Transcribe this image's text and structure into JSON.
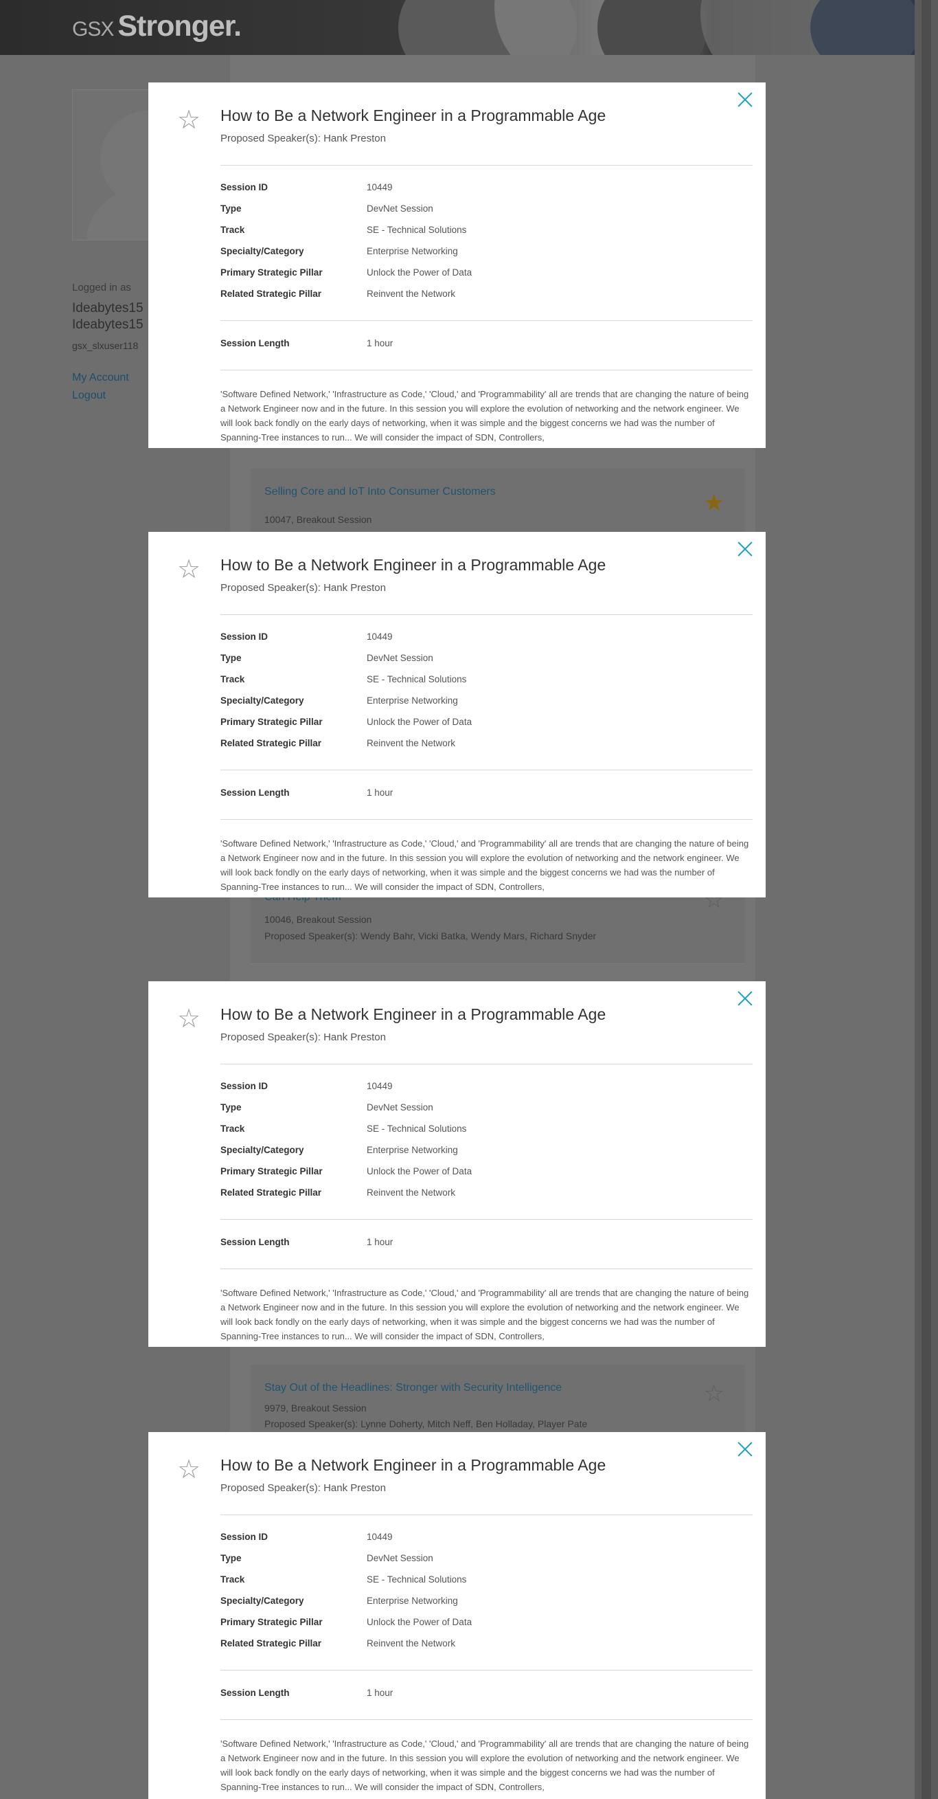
{
  "banner": {
    "logo_prefix": "GSX",
    "logo_word": "Stronger."
  },
  "sidebar": {
    "logged_in_label": "Logged in as",
    "user_line1": "Ideabytes15",
    "user_line2": "Ideabytes15",
    "user_id": "gsx_slxuser118",
    "my_account": "My Account",
    "logout": "Logout"
  },
  "background_sessions": [
    {
      "title": "Selling Core and IoT Into Consumer Customers",
      "meta": "10047, Breakout Session",
      "speakers": "",
      "favorited": true
    },
    {
      "title": "Can Help Them",
      "meta": "10046, Breakout Session",
      "speakers": "Proposed Speaker(s): Wendy Bahr,  Vicki Batka,  Wendy Mars,  Richard Snyder",
      "favorited": false
    },
    {
      "title": "Stay Out of the Headlines: Stronger with Security Intelligence",
      "meta": "9979, Breakout Session",
      "speakers": "Proposed Speaker(s): Lynne Doherty,  Mitch Neff,  Ben Holladay,  Player Pate",
      "favorited": false
    }
  ],
  "modal": {
    "title": "How to Be a Network Engineer in a Programmable Age",
    "speakers": "Proposed Speaker(s): Hank Preston",
    "details": [
      {
        "label": "Session ID",
        "value": "10449"
      },
      {
        "label": "Type",
        "value": "DevNet Session"
      },
      {
        "label": "Track",
        "value": "SE - Technical Solutions"
      },
      {
        "label": "Specialty/Category",
        "value": "Enterprise Networking"
      },
      {
        "label": "Primary Strategic Pillar",
        "value": "Unlock the Power of Data"
      },
      {
        "label": "Related Strategic Pillar",
        "value": "Reinvent the Network"
      }
    ],
    "length_label": "Session Length",
    "length_value": "1 hour",
    "description": "'Software Defined Network,' 'Infrastructure as Code,' 'Cloud,' and 'Programmability' all are trends that are changing the nature of being a Network Engineer now and in the future. In this session you will explore the evolution of networking and the network engineer. We will look back fondly on the early days of networking, when it was simple and the biggest concerns we had was the number of Spanning-Tree instances to run... We will consider the impact of SDN, Controllers,",
    "star_icon": "star-outline-icon",
    "close_icon": "close-icon",
    "accent_color": "#1aa0c6"
  }
}
